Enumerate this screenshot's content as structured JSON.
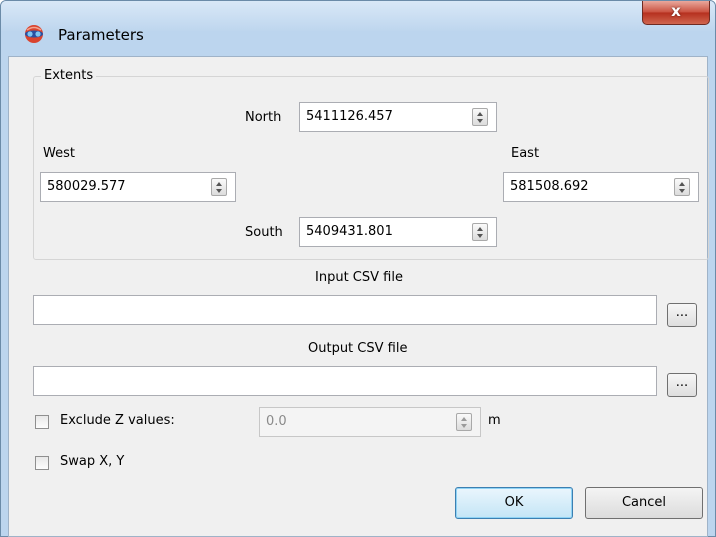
{
  "window": {
    "title": "Parameters",
    "close_glyph": "x",
    "icon": "globe-app-icon"
  },
  "extents": {
    "group_title": "Extents",
    "north": {
      "label": "North",
      "value": "5411126.457"
    },
    "west": {
      "label": "West",
      "value": "580029.577"
    },
    "east": {
      "label": "East",
      "value": "581508.692"
    },
    "south": {
      "label": "South",
      "value": "5409431.801"
    }
  },
  "input_csv": {
    "label": "Input CSV file",
    "value": "",
    "browse_label": "..."
  },
  "output_csv": {
    "label": "Output CSV file",
    "value": "",
    "browse_label": "..."
  },
  "exclude_z": {
    "label": "Exclude Z values:",
    "checked": false,
    "value": "0.0",
    "unit": "m"
  },
  "swap_xy": {
    "label": "Swap X, Y",
    "checked": false
  },
  "buttons": {
    "ok": "OK",
    "cancel": "Cancel"
  }
}
